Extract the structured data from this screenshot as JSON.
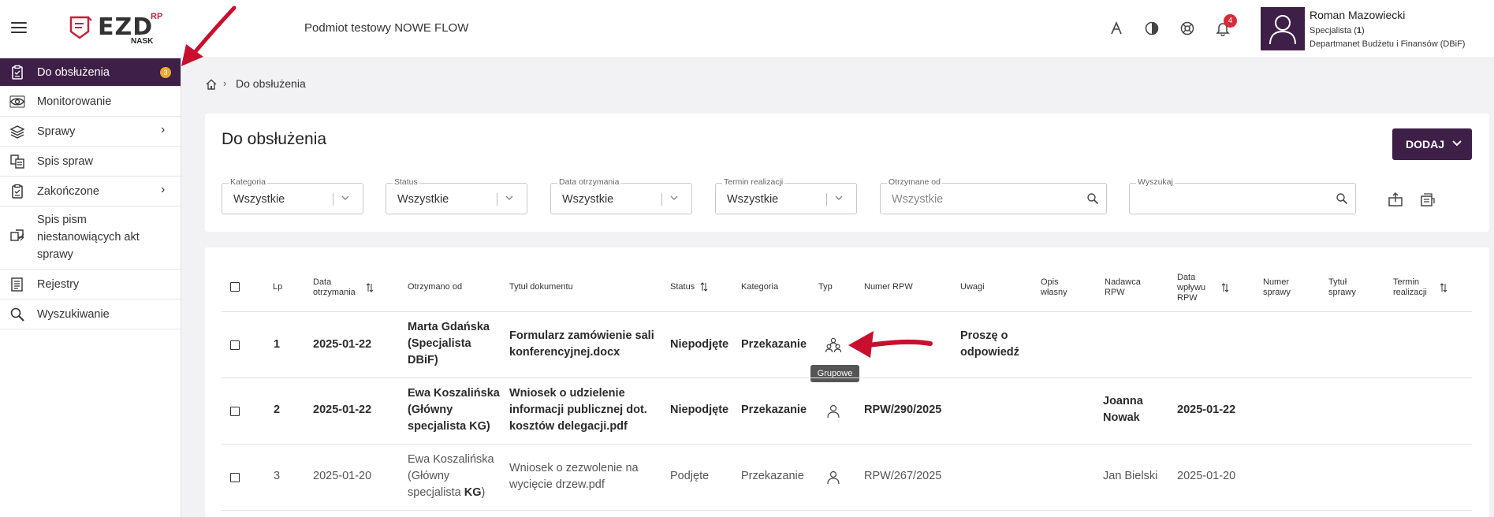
{
  "header": {
    "logo_text": "EZD",
    "logo_sup": "RP",
    "logo_sub": "NASK",
    "org_name": "Podmiot testowy NOWE FLOW",
    "notifications_count": "4",
    "user": {
      "name": "Roman Mazowiecki",
      "role_prefix": "Specjalista (",
      "role_count": "1",
      "role_suffix": ")",
      "department": "Departmanet Budżetu i Finansów (DBiF)"
    }
  },
  "sidebar": {
    "items": [
      {
        "label": "Do obsłużenia",
        "badge": "3",
        "icon": "clipboard-check-icon"
      },
      {
        "label": "Monitorowanie",
        "icon": "eye-icon"
      },
      {
        "label": "Sprawy",
        "icon": "layers-icon"
      },
      {
        "label": "Spis spraw",
        "icon": "documents-list-icon"
      },
      {
        "label": "Zakończone",
        "icon": "clipboard-done-icon"
      },
      {
        "label": "Spis pism niestanowiących akt sprawy",
        "icon": "boxes-icon"
      },
      {
        "label": "Rejestry",
        "icon": "register-book-icon"
      },
      {
        "label": "Wyszukiwanie",
        "icon": "search-icon"
      }
    ]
  },
  "breadcrumb": {
    "current": "Do obsłużenia"
  },
  "page": {
    "title": "Do obsłużenia",
    "add_button": "DODAJ"
  },
  "filters": {
    "kategoria": {
      "label": "Kategoria",
      "value": "Wszystkie"
    },
    "status": {
      "label": "Status",
      "value": "Wszystkie"
    },
    "data_otrzymania": {
      "label": "Data otrzymania",
      "value": "Wszystkie"
    },
    "termin": {
      "label": "Termin realizacji",
      "value": "Wszystkie"
    },
    "otrzymane_od": {
      "label": "Otrzymane od",
      "placeholder": "Wszystkie"
    },
    "wyszukaj": {
      "label": "Wyszukaj",
      "placeholder": ""
    }
  },
  "table": {
    "headers": {
      "lp": "Lp",
      "data_otrzymania": [
        "Data",
        "otrzymania"
      ],
      "otrzymano_od": "Otrzymano od",
      "tytul": "Tytuł dokumentu",
      "status": "Status",
      "kategoria": "Kategoria",
      "typ": "Typ",
      "numer_rpw": "Numer RPW",
      "uwagi": "Uwagi",
      "opis": [
        "Opis",
        "własny"
      ],
      "nadawca": [
        "Nadawca",
        "RPW"
      ],
      "data_wplywu": [
        "Data",
        "wpływu",
        "RPW"
      ],
      "numer_sprawy": [
        "Numer",
        "sprawy"
      ],
      "tytul_sprawy": [
        "Tytuł",
        "sprawy"
      ],
      "termin": [
        "Termin",
        "realizacji"
      ]
    },
    "rows": [
      {
        "lp": "1",
        "data": "2025-01-22",
        "od": [
          "Marta Gdańska",
          "(Specjalista",
          "DBiF)"
        ],
        "tytul": [
          "Formularz zamówienie sali",
          "konferencyjnej.docx"
        ],
        "status": "Niepodjęte",
        "kategoria": "Przekazanie",
        "typ_icon": "group-users-icon",
        "rpw": "",
        "uwagi": [
          "Proszę o",
          "odpowiedź"
        ],
        "nadawca": [
          "",
          ""
        ],
        "data_wplywu": "",
        "bold": true
      },
      {
        "lp": "2",
        "data": "2025-01-22",
        "od": [
          "Ewa Koszalińska",
          "(Główny",
          "specjalista KG)"
        ],
        "tytul": [
          "Wniosek o udzielenie",
          "informacji publicznej dot.",
          "kosztów delegacji.pdf"
        ],
        "status": "Niepodjęte",
        "kategoria": "Przekazanie",
        "typ_icon": "user-icon",
        "rpw": "RPW/290/2025",
        "uwagi": [
          "",
          ""
        ],
        "nadawca": [
          "Joanna",
          "Nowak"
        ],
        "data_wplywu": "2025-01-22",
        "bold": true
      },
      {
        "lp": "3",
        "data": "2025-01-20",
        "od": [
          "Ewa Koszalińska",
          "(Główny",
          "specjalista ",
          "KG",
          ")"
        ],
        "tytul": [
          "Wniosek o zezwolenie na",
          "wycięcie drzew.pdf"
        ],
        "status": "Podjęte",
        "kategoria": "Przekazanie",
        "typ_icon": "user-icon",
        "rpw": "RPW/267/2025",
        "uwagi": [
          "",
          ""
        ],
        "nadawca": [
          "Jan Bielski",
          ""
        ],
        "data_wplywu": "2025-01-20",
        "bold": false
      }
    ],
    "tooltip": "Grupowe"
  },
  "colors": {
    "brand": "#3e1f47",
    "badge": "#f0a830",
    "notification": "#d92b3a",
    "annotation_arrow": "#c8102e"
  }
}
